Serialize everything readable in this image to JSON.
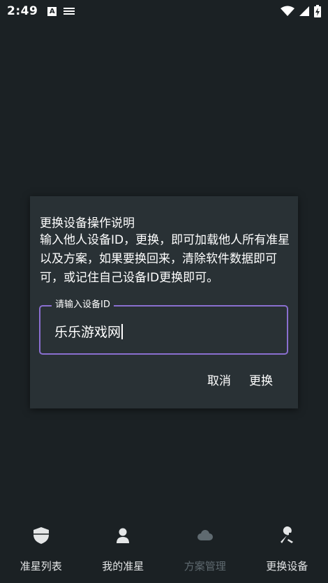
{
  "status_bar": {
    "time": "2:49",
    "notification_icons": [
      "a-square-icon",
      "keyboard-icon"
    ],
    "right_icons": [
      "wifi-icon",
      "cellular-signal-icon",
      "battery-charging-icon"
    ]
  },
  "dialog": {
    "title": "更换设备操作说明",
    "message": "输入他人设备ID，更换，即可加载他人所有准星以及方案，如果要换回来，清除软件数据即可可，或记住自己设备ID更换即可。",
    "input": {
      "label": "请输入设备ID",
      "value": "乐乐游戏网"
    },
    "cancel_label": "取消",
    "confirm_label": "更换"
  },
  "bottom_nav": {
    "active_index": 2,
    "items": [
      {
        "label": "准星列表",
        "icon": "shield-icon"
      },
      {
        "label": "我的准星",
        "icon": "user-icon"
      },
      {
        "label": "方案管理",
        "icon": "cloud-icon"
      },
      {
        "label": "更换设备",
        "icon": "wrench-icon"
      }
    ]
  },
  "colors": {
    "background": "#1b2124",
    "dialog_background": "#293135",
    "input_border": "#8a6fd0",
    "nav_inactive_text": "#e4e6e7",
    "nav_active_text": "#5f6a70"
  }
}
